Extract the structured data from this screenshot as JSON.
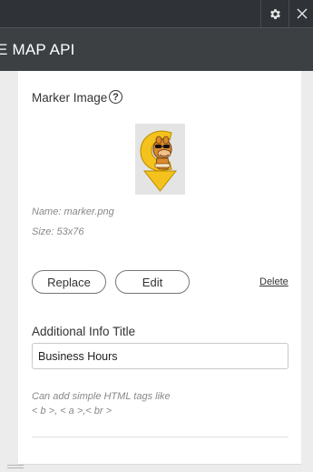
{
  "header": {
    "title": "E MAP API",
    "settings_icon": "gear-icon",
    "close_icon": "close-icon"
  },
  "marker": {
    "label": "Marker Image",
    "help_glyph": "?",
    "name_text": "Name: marker.png",
    "size_text": "Size: 53x76"
  },
  "actions": {
    "replace_label": "Replace",
    "edit_label": "Edit",
    "delete_label": "Delete"
  },
  "info": {
    "label": "Additional Info Title",
    "value": "Business Hours",
    "hint_line1": "Can add simple HTML tags like",
    "hint_line2": "< b >, < a >,< br >"
  },
  "colors": {
    "topbar": "#2f3236",
    "titlebar": "#3c4043",
    "marker_yellow": "#f4c21c"
  }
}
